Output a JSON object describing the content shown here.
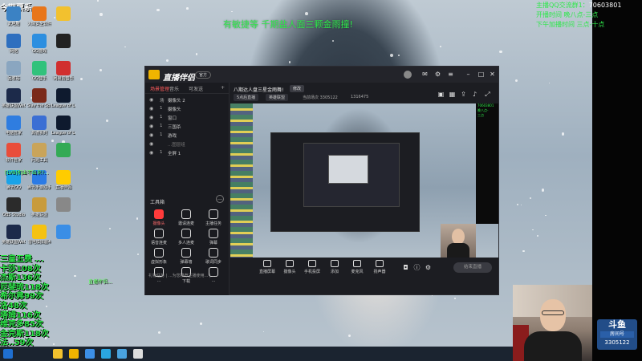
{
  "desktop": {
    "top_left_title": "今期票系",
    "marquee": "有敏捷等 千期盐人面三颗金雨撞!",
    "qq_info_lines": [
      {
        "label": "主播QQ交流群1：",
        "value": "70603801"
      },
      {
        "label": "开播时间 晚八点-三点",
        "value": ""
      },
      {
        "label": "下午加播时间 三点-十点",
        "value": ""
      }
    ],
    "icons": [
      {
        "label": "此电脑",
        "color": "#3b82c4"
      },
      {
        "label": "火绒安全软件",
        "color": "#e8761b"
      },
      {
        "label": "",
        "color": "#f2c12e"
      },
      {
        "label": "网络",
        "color": "#2e6fbf"
      },
      {
        "label": "QQ游戏",
        "color": "#2d8fe0"
      },
      {
        "label": "",
        "color": "#222222"
      },
      {
        "label": "回收站",
        "color": "#8aa6c0"
      },
      {
        "label": "QQ音乐",
        "color": "#31c27c"
      },
      {
        "label": "网易云音乐",
        "color": "#d12f2f"
      },
      {
        "label": "英雄联盟WeGame版",
        "color": "#1c2a4a"
      },
      {
        "label": "Slay the Spire",
        "color": "#7a2a1a"
      },
      {
        "label": "League of Legends",
        "color": "#0e1a2e"
      },
      {
        "label": "电脑管家",
        "color": "#2f7de0"
      },
      {
        "label": "高德实时",
        "color": "#3b6fd4"
      },
      {
        "label": "League of Legends",
        "color": "#0e1a2e"
      },
      {
        "label": "软件管家",
        "color": "#e94d3a"
      },
      {
        "label": "问题工具",
        "color": "#c9a45a"
      },
      {
        "label": "",
        "color": "#33aa55"
      },
      {
        "label": "腾讯QQ",
        "color": "#1aa3e8"
      },
      {
        "label": "腾讯手游助手",
        "color": "#2c7be5"
      },
      {
        "label": "直播伴侣",
        "color": "#ffcc00"
      },
      {
        "label": "OBS Studio",
        "color": "#2b2b2b"
      },
      {
        "label": "英雄联盟",
        "color": "#c89b3c"
      },
      {
        "label": "",
        "color": "#888888"
      },
      {
        "label": "英雄联盟WeGame版",
        "color": "#1c2a4a"
      },
      {
        "label": "雷电模拟器4",
        "color": "#f5c211"
      },
      {
        "label": "",
        "color": "#3a8ee6"
      }
    ],
    "mid_green_text": "[LVB]机出不出来?...",
    "gift_list": [
      "三皇五费 ...",
      "卡莎108次",
      "杰斯136次",
      "厄斐琉118次",
      "希尔弗99次",
      "洛48次",
      "塔姆116次",
      "维克多85次",
      "金克斯118次",
      "法..59次"
    ],
    "bottom_overlay": "直播伴侣...",
    "taskbar_icons": [
      "#f2c12e",
      "#f0b400",
      "#3c8fe6",
      "#2aa6e0",
      "#4aa3df",
      "#dddddd"
    ]
  },
  "app": {
    "name": "直播伴侣",
    "version": "官方",
    "tabs": [
      "场景管理",
      "音乐",
      "可发送"
    ],
    "scenes": [
      {
        "n": "场",
        "t": "摄像头 2",
        "dim": false
      },
      {
        "n": "1",
        "t": "摄像头",
        "dim": false
      },
      {
        "n": "1",
        "t": "窗口",
        "dim": false
      },
      {
        "n": "1",
        "t": "三国杀",
        "dim": false
      },
      {
        "n": "1",
        "t": "游戏",
        "dim": false
      },
      {
        "n": "",
        "t": "...图层组",
        "dim": true
      },
      {
        "n": "1",
        "t": "全屏 1",
        "dim": false
      }
    ],
    "tools_title": "工具箱",
    "tools": [
      {
        "label": "摄像头",
        "red": true
      },
      {
        "label": "邀请连麦",
        "red": false
      },
      {
        "label": "主播任务",
        "red": false
      },
      {
        "label": "语音连麦",
        "red": false
      },
      {
        "label": "多人连麦",
        "red": false
      },
      {
        "label": "弹幕",
        "red": false
      },
      {
        "label": "虚拟形象",
        "red": false
      },
      {
        "label": "弹幕墙",
        "red": false
      },
      {
        "label": "歌词同步",
        "red": false
      },
      {
        "label": "...",
        "red": false
      },
      {
        "label": "下载",
        "red": false
      },
      {
        "label": "...",
        "red": false
      }
    ],
    "footer": "礼物任务  |  ...为您推荐主播使用...  |  ...",
    "room_title": "八期达人盘三星金雨舞!",
    "room_tag": "修改",
    "chips": [
      "5点后直播",
      "英雄联盟"
    ],
    "room_meta": [
      "当前场次 3305122",
      "1316475"
    ],
    "controls": [
      {
        "label": "直播屏幕"
      },
      {
        "label": "摄像头"
      },
      {
        "label": "手机投屏"
      },
      {
        "label": "添加"
      },
      {
        "label": "麦克风"
      },
      {
        "label": "扬声器"
      }
    ],
    "go_live": "结束直播",
    "right_strip": [
      "70603801",
      "晚八点-",
      "三点"
    ]
  },
  "overlay": {
    "platform": "斗鱼",
    "sub": "房间号",
    "room_id": "3305122"
  }
}
